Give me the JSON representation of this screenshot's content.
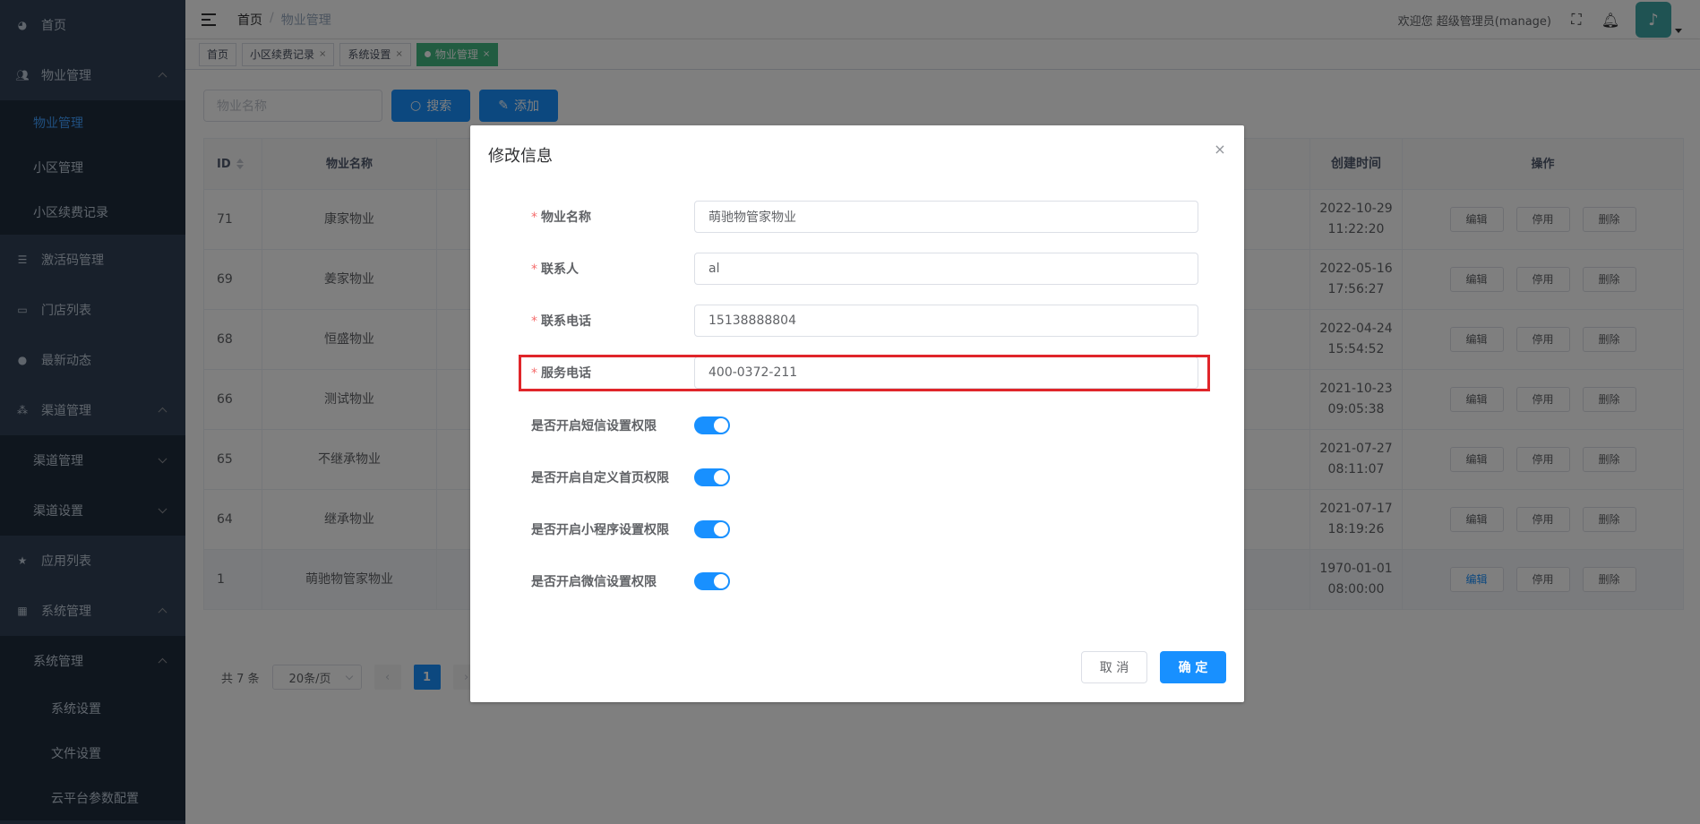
{
  "sidebar": {
    "items": [
      {
        "label": "首页",
        "icon": "dashboard-icon"
      },
      {
        "label": "物业管理",
        "icon": "users-icon"
      },
      {
        "label": "物业管理"
      },
      {
        "label": "小区管理"
      },
      {
        "label": "小区续费记录"
      },
      {
        "label": "激活码管理",
        "icon": "list-icon"
      },
      {
        "label": "门店列表",
        "icon": "store-icon"
      },
      {
        "label": "最新动态",
        "icon": "chat-icon"
      },
      {
        "label": "渠道管理",
        "icon": "tree-icon"
      },
      {
        "label": "渠道管理"
      },
      {
        "label": "渠道设置"
      },
      {
        "label": "应用列表",
        "icon": "star-icon"
      },
      {
        "label": "系统管理",
        "icon": "grid-icon"
      },
      {
        "label": "系统管理"
      },
      {
        "label": "系统设置"
      },
      {
        "label": "文件设置"
      },
      {
        "label": "云平台参数配置"
      }
    ]
  },
  "header": {
    "breadcrumb": [
      "首页",
      "/",
      "物业管理"
    ],
    "welcome": "欢迎您 超级管理员(manage)"
  },
  "tags": [
    "首页",
    "小区续费记录",
    "系统设置",
    "物业管理"
  ],
  "main": {
    "search_placeholder": "物业名称",
    "search_button": "搜索",
    "add_button": "添加",
    "table": {
      "headers": [
        "ID",
        "物业名称",
        "创建时间",
        "操作"
      ],
      "rows": [
        {
          "id": "71",
          "name": "康家物业",
          "date": "2022-10-29",
          "time": "11:22:20"
        },
        {
          "id": "69",
          "name": "姜家物业",
          "date": "2022-05-16",
          "time": "17:56:27"
        },
        {
          "id": "68",
          "name": "恒盛物业",
          "date": "2022-04-24",
          "time": "15:54:52"
        },
        {
          "id": "66",
          "name": "测试物业",
          "date": "2021-10-23",
          "time": "09:05:38"
        },
        {
          "id": "65",
          "name": "不继承物业",
          "date": "2021-07-27",
          "time": "08:11:07"
        },
        {
          "id": "64",
          "name": "继承物业",
          "date": "2021-07-17",
          "time": "18:19:26"
        },
        {
          "id": "1",
          "name": "萌驰物管家物业",
          "date": "1970-01-01",
          "time": "08:00:00"
        }
      ],
      "op_edit": "编辑",
      "op_disable": "停用",
      "op_delete": "删除"
    },
    "pager": {
      "total": "共 7 条",
      "page_size": "20条/页",
      "current_page": "1",
      "prev": "‹",
      "next": "›"
    }
  },
  "dialog": {
    "title": "修改信息",
    "close": "×",
    "fields": [
      {
        "label": "物业名称",
        "value": "萌驰物管家物业",
        "required": true
      },
      {
        "label": "联系人",
        "value": "al",
        "required": true
      },
      {
        "label": "联系电话",
        "value": "15138888804",
        "required": true
      },
      {
        "label": "服务电话",
        "value": "400-0372-211",
        "required": true
      }
    ],
    "switches": [
      {
        "label": "是否开启短信设置权限",
        "on": true
      },
      {
        "label": "是否开启自定义首页权限",
        "on": true
      },
      {
        "label": "是否开启小程序设置权限",
        "on": true
      },
      {
        "label": "是否开启微信设置权限",
        "on": true
      }
    ],
    "required_mark": "*",
    "cancel": "取 消",
    "confirm": "确 定"
  },
  "colors": {
    "primary": "#1890ff",
    "sidebar_bg": "#304156",
    "sidebar_active": "#409eff",
    "tag_active": "#42b983",
    "highlight": "#e0252a"
  }
}
